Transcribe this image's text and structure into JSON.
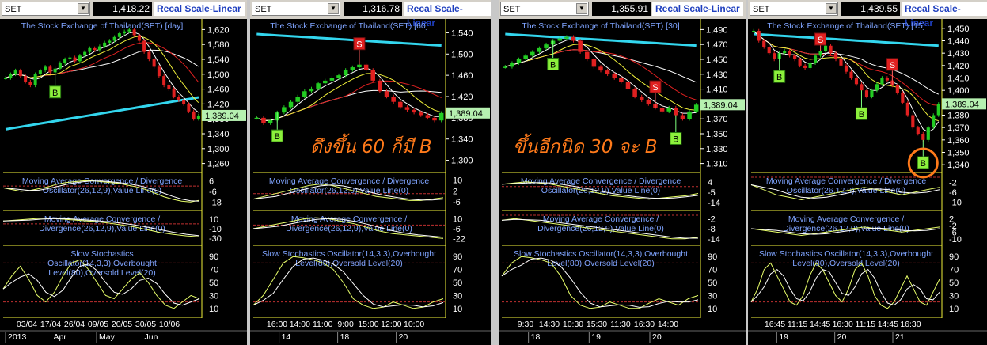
{
  "toolbar": {
    "recal_label": "Recal Scale-Linear"
  },
  "annotations": [
    "ดึงขึ้น 60 ก็มี B",
    "ขึ้นอีกนิด 30 จะ B"
  ],
  "colors": {
    "background": "#000000",
    "ma_cyan": "#33d6ee",
    "ma_red": "#e02020",
    "ma_white": "#ffffff",
    "ma_yellow": "#f0f03a",
    "candle_up": "#22cc22",
    "candle_down": "#e02020",
    "label_blue": "#7fa4ff",
    "last_price_bg": "#b6f0b0",
    "orange_marker": "#ff7a1a"
  },
  "chart_data": [
    {
      "type": "candlestick",
      "symbol": "SET",
      "price_label": "1,418.22",
      "title": "The Stock Exchange of Thailand(SET) [day]",
      "last_price": "1,389.04",
      "y_ticks": [
        "1,620",
        "1,580",
        "1,540",
        "1,500",
        "1,460",
        "1,420",
        "1,380",
        "1,340",
        "1,300",
        "1,260"
      ],
      "y_range": [
        1240,
        1640
      ],
      "close": [
        1490,
        1500,
        1510,
        1495,
        1480,
        1470,
        1500,
        1510,
        1520,
        1505,
        1515,
        1530,
        1540,
        1545,
        1535,
        1550,
        1560,
        1570,
        1565,
        1575,
        1585,
        1590,
        1600,
        1610,
        1615,
        1620,
        1605,
        1590,
        1560,
        1540,
        1520,
        1495,
        1470,
        1460,
        1440,
        1430,
        1420,
        1400,
        1380,
        1389
      ],
      "signals": [
        {
          "type": "B",
          "index": 10
        }
      ],
      "macd1": {
        "title": "Moving Average Convergence / Divergence Oscillator(26,12,9),Value Line(0)",
        "ticks": [
          "6",
          "-6",
          "-18"
        ],
        "range": [
          -24,
          10
        ],
        "values": [
          -2,
          -4,
          -6,
          -5,
          -3,
          -1,
          2,
          4,
          5,
          6,
          6,
          5,
          4,
          3,
          1,
          -1,
          -4,
          -8,
          -12,
          -15,
          -17,
          -18,
          -16
        ]
      },
      "macd2": {
        "title": "Moving Average Convergence / Divergence(26,12,9),Value Line(0)",
        "ticks": [
          "10",
          "-10",
          "-30"
        ],
        "range": [
          -38,
          18
        ],
        "values": [
          6,
          8,
          10,
          12,
          11,
          9,
          7,
          5,
          2,
          -2,
          -6,
          -12,
          -18,
          -22,
          -25,
          -27
        ]
      },
      "stoch": {
        "title": "Slow Stochastics Oscillator(14,3,3),Overbought Level(80),Oversold Level(20)",
        "ticks": [
          "90",
          "70",
          "50",
          "30",
          "10"
        ],
        "values": [
          40,
          60,
          75,
          55,
          30,
          20,
          35,
          60,
          80,
          85,
          70,
          50,
          30,
          25,
          40,
          55,
          65,
          50,
          30,
          15,
          10,
          20,
          30,
          25
        ]
      },
      "x_row1": [
        "03/04",
        "17/04",
        "26/04",
        "09/05",
        "20/05",
        "30/05",
        "10/06"
      ],
      "x_row2": [
        "2013",
        "Apr",
        "May",
        "Jun"
      ]
    },
    {
      "type": "candlestick",
      "symbol": "SET",
      "price_label": "1,316.78",
      "title": "The Stock Exchange of Thailand(SET) [60]",
      "last_price": "1,389.04",
      "y_ticks": [
        "1,540",
        "1,500",
        "1,460",
        "1,420",
        "1,380",
        "1,340",
        "1,300"
      ],
      "y_range": [
        1280,
        1560
      ],
      "close": [
        1380,
        1370,
        1375,
        1390,
        1400,
        1410,
        1420,
        1430,
        1435,
        1445,
        1450,
        1455,
        1460,
        1470,
        1475,
        1480,
        1470,
        1450,
        1430,
        1420,
        1410,
        1400,
        1395,
        1390,
        1385,
        1380,
        1375,
        1389
      ],
      "signals": [
        {
          "type": "B",
          "index": 3
        },
        {
          "type": "S",
          "index": 15
        }
      ],
      "macd1": {
        "title": "Moving Average Convergence / Divergence Oscillator(26,12,9),Value Line(0)",
        "ticks": [
          "10",
          "2",
          "-6"
        ],
        "range": [
          -10,
          12
        ],
        "values": [
          -4,
          -2,
          0,
          2,
          4,
          6,
          7,
          6,
          4,
          2,
          0,
          -2,
          -3,
          -4,
          -5,
          -5,
          -4,
          -3
        ]
      },
      "macd2": {
        "title": "Moving Average Convergence / Divergence(26,12,9),Value Line(0)",
        "ticks": [
          "10",
          "-6",
          "-22"
        ],
        "range": [
          -28,
          16
        ],
        "values": [
          -6,
          -2,
          2,
          6,
          10,
          12,
          10,
          6,
          2,
          -4,
          -10,
          -14,
          -16,
          -18,
          -20,
          -22
        ]
      },
      "stoch": {
        "title": "Slow Stochastics Oscillator(14,3,3),Overbought Level(80),Oversold Level(20)",
        "ticks": [
          "90",
          "70",
          "50",
          "30",
          "10"
        ],
        "values": [
          15,
          30,
          55,
          80,
          90,
          88,
          85,
          80,
          70,
          50,
          25,
          15,
          10,
          12,
          20,
          15,
          10,
          12,
          20,
          25
        ]
      },
      "x_row1": [
        "16:00",
        "14:00",
        "11:00",
        "9:00",
        "15:00",
        "12:00",
        "10:00"
      ],
      "x_row2": [
        "14",
        "18",
        "20"
      ]
    },
    {
      "type": "candlestick",
      "symbol": "SET",
      "price_label": "1,355.91",
      "title": "The Stock Exchange of Thailand(SET) [30]",
      "last_price": "1,389.04",
      "y_ticks": [
        "1,490",
        "1,470",
        "1,450",
        "1,430",
        "1,410",
        "1,390",
        "1,370",
        "1,350",
        "1,330",
        "1,310"
      ],
      "y_range": [
        1300,
        1500
      ],
      "close": [
        1440,
        1445,
        1450,
        1455,
        1460,
        1465,
        1470,
        1475,
        1478,
        1480,
        1475,
        1460,
        1450,
        1440,
        1435,
        1430,
        1425,
        1420,
        1410,
        1400,
        1395,
        1390,
        1385,
        1380,
        1385,
        1375,
        1370,
        1380,
        1389
      ],
      "signals": [
        {
          "type": "B",
          "index": 7
        },
        {
          "type": "S",
          "index": 22
        },
        {
          "type": "B",
          "index": 25
        }
      ],
      "macd1": {
        "title": "Moving Average Convergence / Divergence Oscillator(26,12,9),Value Line(0)",
        "ticks": [
          "4",
          "-5",
          "-14"
        ],
        "range": [
          -18,
          8
        ],
        "values": [
          2,
          3,
          4,
          3,
          2,
          0,
          -2,
          -4,
          -6,
          -8,
          -9,
          -10,
          -11,
          -10,
          -9,
          -8,
          -6
        ]
      },
      "macd2": {
        "title": "Moving Average Convergence / Divergence(26,12,9),Value Line(0)",
        "ticks": [
          "-2",
          "-8",
          "-14"
        ],
        "range": [
          -16,
          0
        ],
        "values": [
          -3,
          -2,
          -3,
          -4,
          -5,
          -6,
          -7,
          -8,
          -9,
          -10,
          -11,
          -12,
          -13,
          -14,
          -14,
          -13
        ]
      },
      "stoch": {
        "title": "Slow Stochastics Oscillator(14,3,3),Overbought Level(80),Oversold Level(20)",
        "ticks": [
          "90",
          "70",
          "50",
          "30",
          "10"
        ],
        "values": [
          60,
          80,
          90,
          88,
          85,
          80,
          60,
          30,
          15,
          10,
          12,
          20,
          15,
          10,
          10,
          18,
          25,
          20,
          15,
          25,
          30
        ]
      },
      "x_row1": [
        "9:30",
        "14:30",
        "10:30",
        "15:30",
        "11:30",
        "16:30",
        "14:00"
      ],
      "x_row2": [
        "18",
        "19",
        "20"
      ]
    },
    {
      "type": "candlestick",
      "symbol": "SET",
      "price_label": "1,439.55",
      "title": "The Stock Exchange of Thailand(SET) [15]",
      "last_price": "1,389.04",
      "y_ticks": [
        "1,450",
        "1,440",
        "1,430",
        "1,420",
        "1,410",
        "1,400",
        "1,390",
        "1,380",
        "1,370",
        "1,360",
        "1,350",
        "1,340"
      ],
      "y_range": [
        1335,
        1455
      ],
      "close": [
        1448,
        1440,
        1435,
        1430,
        1425,
        1430,
        1432,
        1428,
        1425,
        1420,
        1418,
        1422,
        1428,
        1432,
        1436,
        1430,
        1425,
        1420,
        1415,
        1410,
        1405,
        1400,
        1395,
        1400,
        1405,
        1410,
        1408,
        1404,
        1398,
        1390,
        1380,
        1370,
        1365,
        1360,
        1370,
        1380,
        1389
      ],
      "signals": [
        {
          "type": "B",
          "index": 5
        },
        {
          "type": "S",
          "index": 13
        },
        {
          "type": "B",
          "index": 21
        },
        {
          "type": "S",
          "index": 27
        },
        {
          "type": "B",
          "index": 33
        }
      ],
      "macd1": {
        "title": "Moving Average Convergence / Divergence Oscillator(26,12,9),Value Line(0)",
        "ticks": [
          "-2",
          "-6",
          "-10"
        ],
        "range": [
          -12,
          0
        ],
        "values": [
          -3,
          -5,
          -7,
          -8,
          -9,
          -8,
          -7,
          -6,
          -5,
          -4,
          -5,
          -6,
          -7,
          -6,
          -5,
          -4
        ]
      },
      "macd2": {
        "title": "Moving Average Convergence / Divergence(26,12,9),Value Line(0)",
        "ticks": [
          "2",
          "-2",
          "-6",
          "-10"
        ],
        "range": [
          -12,
          4
        ],
        "values": [
          -4,
          -5,
          -6,
          -7,
          -8,
          -7,
          -6,
          -5,
          -4,
          -3,
          -4,
          -5,
          -6,
          -5,
          -4,
          -3
        ]
      },
      "stoch": {
        "title": "Slow Stochastics Oscillator(14,3,3),Overbought Level(80),Oversold Level(20)",
        "ticks": [
          "90",
          "70",
          "50",
          "30",
          "10"
        ],
        "values": [
          20,
          40,
          70,
          80,
          60,
          40,
          20,
          15,
          30,
          60,
          80,
          70,
          50,
          30,
          20,
          40,
          70,
          80,
          60,
          30,
          15,
          10,
          20,
          40,
          60,
          40,
          20,
          15,
          35,
          55
        ]
      },
      "x_row1": [
        "16:45",
        "11:15",
        "14:45",
        "16:30",
        "11:15",
        "14:45",
        "16:30"
      ],
      "x_row2": [
        "19",
        "20",
        "21"
      ]
    }
  ]
}
